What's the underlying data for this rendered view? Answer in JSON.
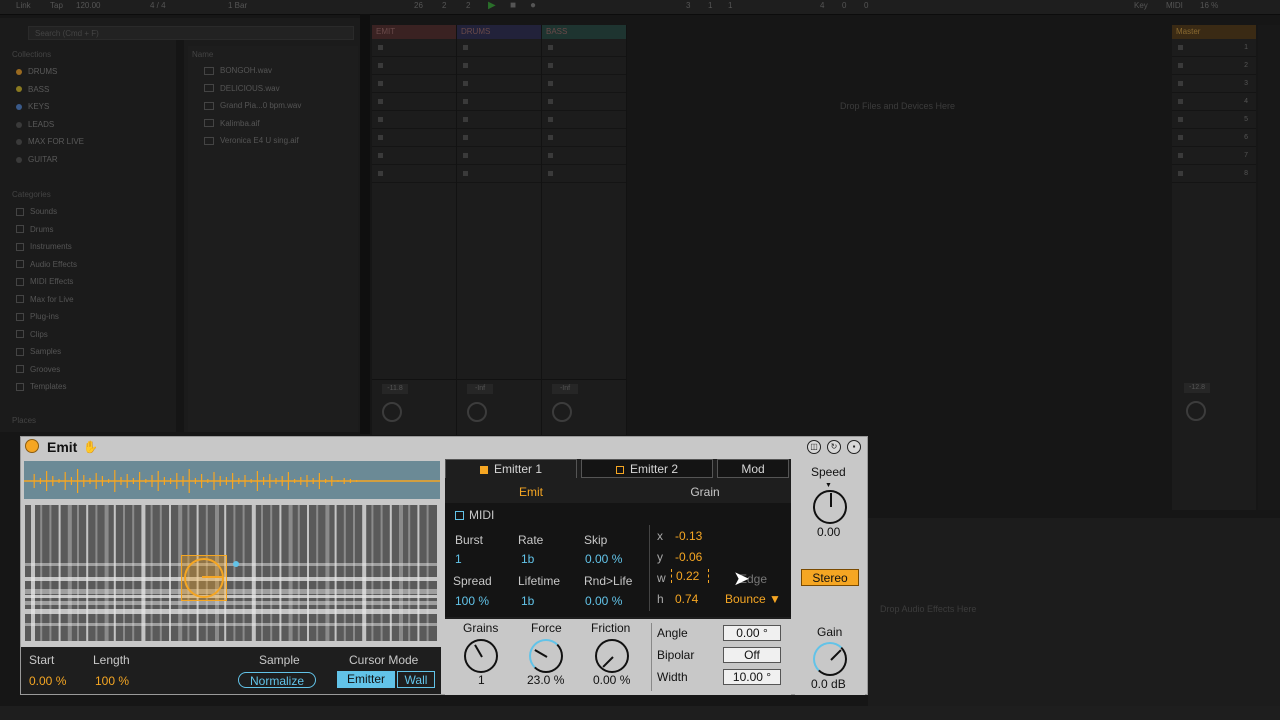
{
  "topbar": {
    "link": "Link",
    "tap": "Tap",
    "tempo": "120.00",
    "sig": "4 / 4",
    "quant": "1 Bar",
    "pos1": "26",
    "pos2": "2",
    "pos3": "2",
    "loop1": "3",
    "loop2": "1",
    "loop3": "1",
    "len1": "4",
    "len2": "0",
    "len3": "0",
    "key": "Key",
    "midi": "MIDI",
    "cpu": "16 %"
  },
  "browser": {
    "search_placeholder": "Search (Cmd + F)",
    "collections_header": "Collections",
    "collections": [
      {
        "label": "DRUMS",
        "color": "#9a6a20"
      },
      {
        "label": "BASS",
        "color": "#8a7a20"
      },
      {
        "label": "KEYS",
        "color": "#3a5a8a"
      },
      {
        "label": "LEADS",
        "color": "#3a3a3a"
      },
      {
        "label": "MAX FOR LIVE",
        "color": "#3a3a3a"
      },
      {
        "label": "GUITAR",
        "color": "#3a3a3a"
      }
    ],
    "categories_header": "Categories",
    "categories": [
      "Sounds",
      "Drums",
      "Instruments",
      "Audio Effects",
      "MIDI Effects",
      "Max for Live",
      "Plug-ins",
      "Clips",
      "Samples",
      "Grooves",
      "Templates"
    ],
    "places_header": "Places",
    "name_header": "Name",
    "files": [
      "BONGOH.wav",
      "DELICIOUS.wav",
      "Grand Pia...0 bpm.wav",
      "Kalimba.aif",
      "Veronica E4 U sing.aif"
    ]
  },
  "tracks": [
    {
      "name": "EMIT",
      "vol": "-11.8"
    },
    {
      "name": "DRUMS",
      "vol": "-Inf"
    },
    {
      "name": "BASS",
      "vol": "-Inf"
    }
  ],
  "drop_files": "Drop Files and Devices Here",
  "master": {
    "name": "Master",
    "vol": "-12.8",
    "slots": [
      "1",
      "2",
      "3",
      "4",
      "5",
      "6",
      "7",
      "8"
    ]
  },
  "drop_effects": "Drop Audio Effects Here",
  "device": {
    "name": "Emit",
    "left": {
      "start_label": "Start",
      "start_value": "0.00 %",
      "length_label": "Length",
      "length_value": "100 %",
      "sample_label": "Sample",
      "normalize": "Normalize",
      "cursor_label": "Cursor Mode",
      "emitter": "Emitter",
      "wall": "Wall"
    },
    "tabs": {
      "emitter1": "Emitter 1",
      "emitter2": "Emitter 2",
      "mod": "Mod"
    },
    "subtabs": {
      "emit": "Emit",
      "grain": "Grain"
    },
    "emit": {
      "midi": "MIDI",
      "burst_label": "Burst",
      "burst_value": "1",
      "rate_label": "Rate",
      "rate_value": "1b",
      "skip_label": "Skip",
      "skip_value": "0.00 %",
      "spread_label": "Spread",
      "spread_value": "100 %",
      "lifetime_label": "Lifetime",
      "lifetime_value": "1b",
      "rnd_label": "Rnd>Life",
      "rnd_value": "0.00 %",
      "x_label": "x",
      "x_value": "-0.13",
      "y_label": "y",
      "y_value": "-0.06",
      "w_label": "w",
      "w_value": "0.22",
      "h_label": "h",
      "h_value": "0.74",
      "edge_label": "Edge",
      "edge_value": "Bounce"
    },
    "bottom": {
      "grains_label": "Grains",
      "grains_value": "1",
      "force_label": "Force",
      "force_value": "23.0 %",
      "friction_label": "Friction",
      "friction_value": "0.00 %",
      "angle_label": "Angle",
      "angle_value": "0.00 °",
      "bipolar_label": "Bipolar",
      "bipolar_value": "Off",
      "width_label": "Width",
      "width_value": "10.00 °"
    },
    "right": {
      "speed_label": "Speed",
      "speed_value": "0.00",
      "stereo": "Stereo",
      "gain_label": "Gain",
      "gain_value": "0.0 dB"
    }
  },
  "colors": {
    "accent_orange": "#f5a623",
    "accent_blue": "#62c3e8",
    "panel_dark": "#1e1e1e",
    "panel_light": "#c8c8c8"
  }
}
